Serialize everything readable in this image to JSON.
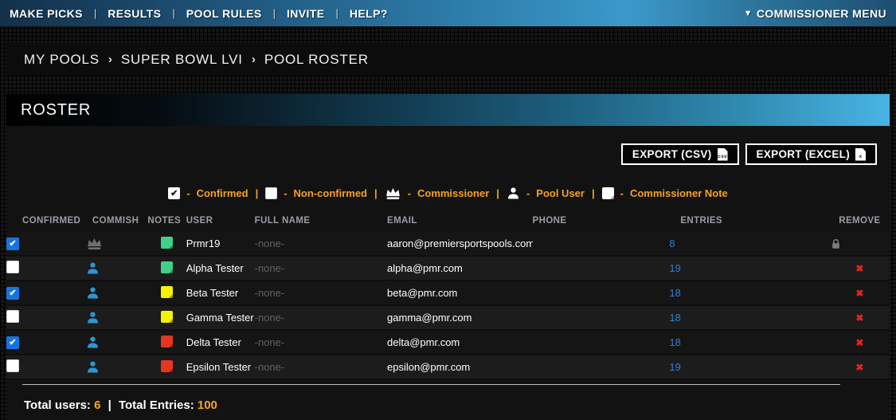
{
  "nav": {
    "items": [
      "MAKE PICKS",
      "RESULTS",
      "POOL RULES",
      "INVITE",
      "HELP?"
    ],
    "separator": "|",
    "dropdown_arrow": "▼",
    "commissioner_menu": "COMMISSIONER MENU"
  },
  "breadcrumb": {
    "items": [
      "MY POOLS",
      "SUPER BOWL LVI",
      "POOL ROSTER"
    ],
    "separator": "›"
  },
  "section": {
    "title": "ROSTER"
  },
  "toolbar": {
    "buttons": [
      {
        "label": "EXPORT (CSV)",
        "icon": "csv-file-icon",
        "icon_label": "csv"
      },
      {
        "label": "EXPORT (EXCEL)",
        "icon": "excel-file-icon",
        "icon_label": "x"
      }
    ]
  },
  "legend": {
    "dash": "-",
    "separator": "|",
    "items": [
      {
        "icon": "checked-checkbox-icon",
        "label": "Confirmed"
      },
      {
        "icon": "unchecked-checkbox-icon",
        "label": "Non-confirmed"
      },
      {
        "icon": "crown-icon",
        "label": "Commissioner"
      },
      {
        "icon": "person-icon",
        "label": "Pool User"
      },
      {
        "icon": "note-icon",
        "label": "Commissioner Note"
      }
    ]
  },
  "table": {
    "headers": [
      "CONFIRMED",
      "COMMISH",
      "NOTES",
      "USER",
      "FULL NAME",
      "EMAIL",
      "PHONE",
      "ENTRIES",
      "REMOVE"
    ],
    "rows": [
      {
        "confirmed": true,
        "role": "commissioner",
        "note_color": "#3FD18C",
        "user": "Prmr19",
        "full_name": "-none-",
        "email": "aaron@premiersportspools.com",
        "phone": "",
        "entries": "8",
        "remove": "locked"
      },
      {
        "confirmed": false,
        "role": "pool_user",
        "note_color": "#3FD18C",
        "user": "Alpha Tester",
        "full_name": "-none-",
        "email": "alpha@pmr.com",
        "phone": "",
        "entries": "19",
        "remove": "removable"
      },
      {
        "confirmed": true,
        "role": "pool_user",
        "note_color": "#F2F202",
        "user": "Beta Tester",
        "full_name": "-none-",
        "email": "beta@pmr.com",
        "phone": "",
        "entries": "18",
        "remove": "removable"
      },
      {
        "confirmed": false,
        "role": "pool_user",
        "note_color": "#F2F202",
        "user": "Gamma Tester",
        "full_name": "-none-",
        "email": "gamma@pmr.com",
        "phone": "",
        "entries": "18",
        "remove": "removable"
      },
      {
        "confirmed": true,
        "role": "pool_user",
        "note_color": "#E63422",
        "user": "Delta Tester",
        "full_name": "-none-",
        "email": "delta@pmr.com",
        "phone": "",
        "entries": "18",
        "remove": "removable"
      },
      {
        "confirmed": false,
        "role": "pool_user",
        "note_color": "#E63422",
        "user": "Epsilon Tester",
        "full_name": "-none-",
        "email": "epsilon@pmr.com",
        "phone": "",
        "entries": "19",
        "remove": "removable"
      }
    ],
    "remove_x_glyph": "✖"
  },
  "footer": {
    "total_users_label": "Total users:",
    "total_users": "6",
    "separator": "|",
    "total_entries_label": "Total Entries:",
    "total_entries": "100"
  },
  "colors": {
    "accent_orange": "#F9A51A",
    "link_blue": "#2E7FD6",
    "person_blue": "#2D96D5",
    "crown_gray": "#6A7076",
    "remove_red": "#E1251B",
    "checkbox_blue": "#1673E1",
    "note_green": "#3FD18C",
    "note_yellow": "#F2F202",
    "note_red": "#E63422",
    "nav_blue": "#2F82B1",
    "roster_bar_blue": "#49B4E4"
  }
}
